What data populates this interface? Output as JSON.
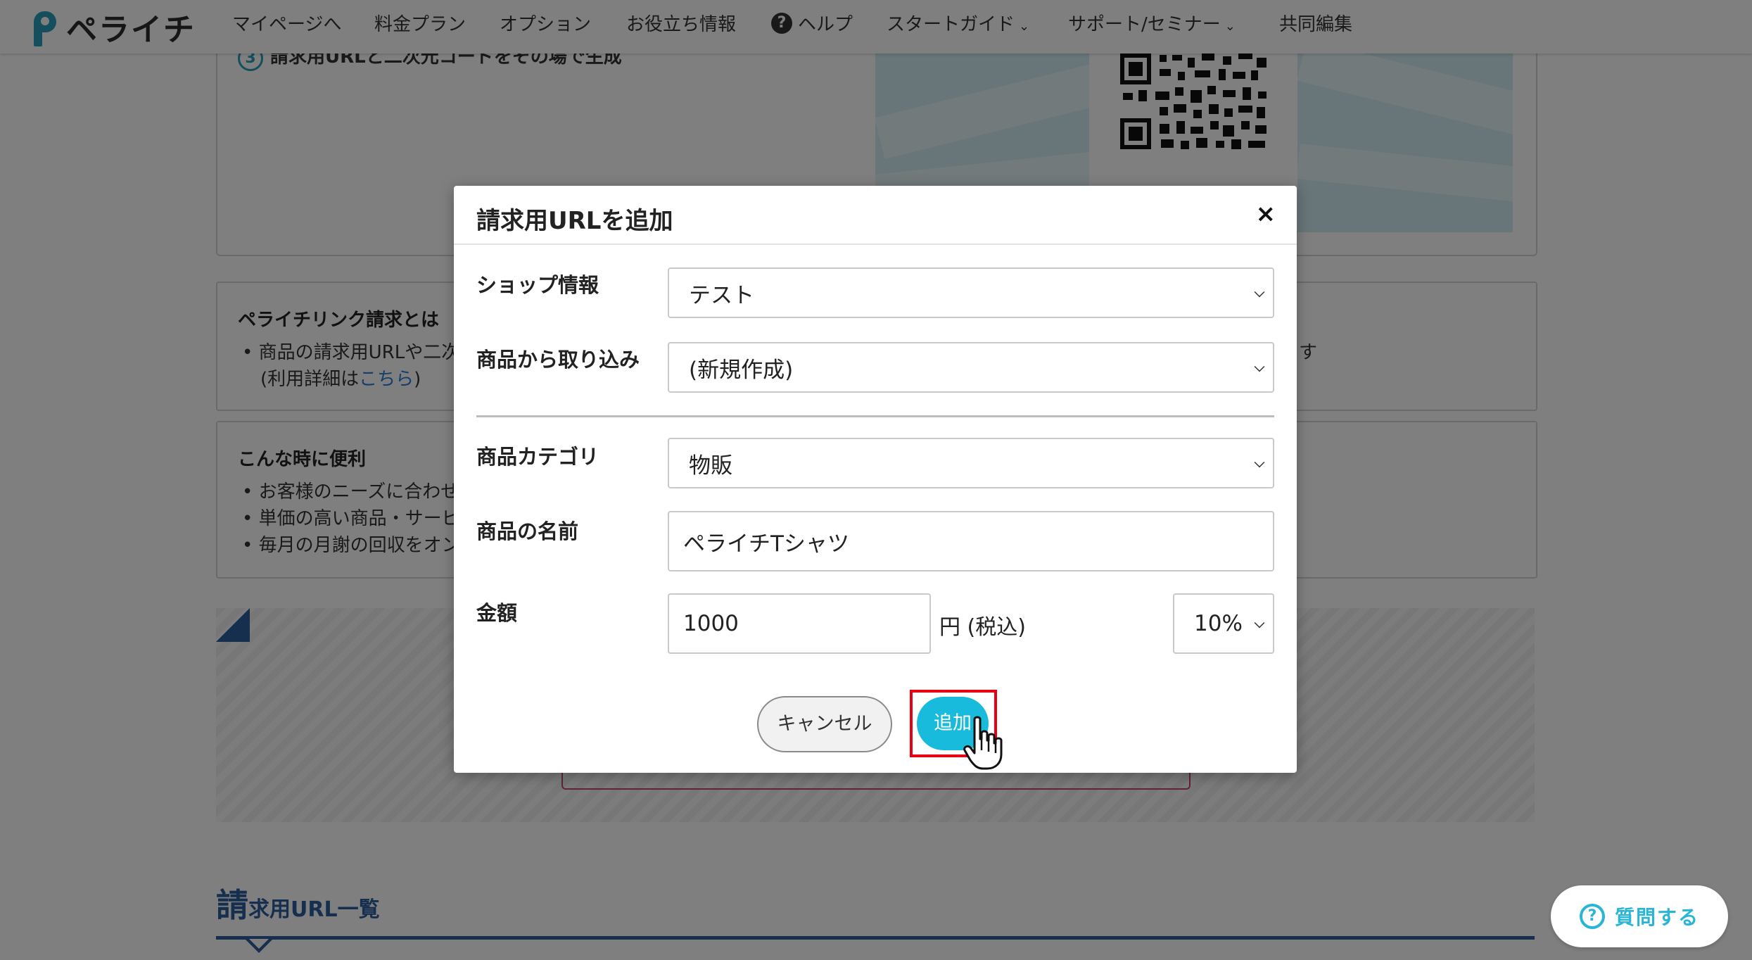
{
  "nav": {
    "logo_text": "ペライチ",
    "items": [
      "マイページへ",
      "料金プラン",
      "オプション",
      "お役立ち情報",
      "ヘルプ",
      "スタートガイド",
      "サポート/セミナー",
      "共同編集"
    ],
    "help_glyph": "?",
    "chevron": "⌄"
  },
  "background": {
    "step_number": "3",
    "step_text": "請求用URLと二次元コードをその場で生成",
    "about": {
      "heading": "ペライチリンク請求とは",
      "line1": "商品の請求用URLや二次",
      "line1_tail": "す",
      "line2_prefix": "(利用詳細は",
      "line2_link": "こちら",
      "line2_suffix": ")"
    },
    "convenient": {
      "heading": "こんな時に便利",
      "items": [
        "お客様のニーズに合わせ",
        "単価の高い商品・サービ",
        "毎月の月謝の回収をオン"
      ]
    },
    "list_heading_big": "請",
    "list_heading_rest": "求用URL一覧"
  },
  "modal": {
    "title": "請求用URLを追加",
    "close_glyph": "×",
    "shop_label": "ショップ情報",
    "shop_value": "テスト",
    "import_label": "商品から取り込み",
    "import_value": "(新規作成)",
    "category_label": "商品カテゴリ",
    "category_value": "物販",
    "name_label": "商品の名前",
    "name_value": "ペライチTシャツ",
    "price_label": "金額",
    "price_value": "1000",
    "price_unit": "円 (税込)",
    "tax_value": "10%",
    "cancel_label": "キャンセル",
    "add_label": "追加"
  },
  "ask_button": {
    "icon": "?",
    "label": "質問する"
  },
  "colors": {
    "brand": "#2a9fbd",
    "add_button": "#19bbdc",
    "highlight": "#e60012",
    "heading_blue": "#2f5f9e"
  }
}
